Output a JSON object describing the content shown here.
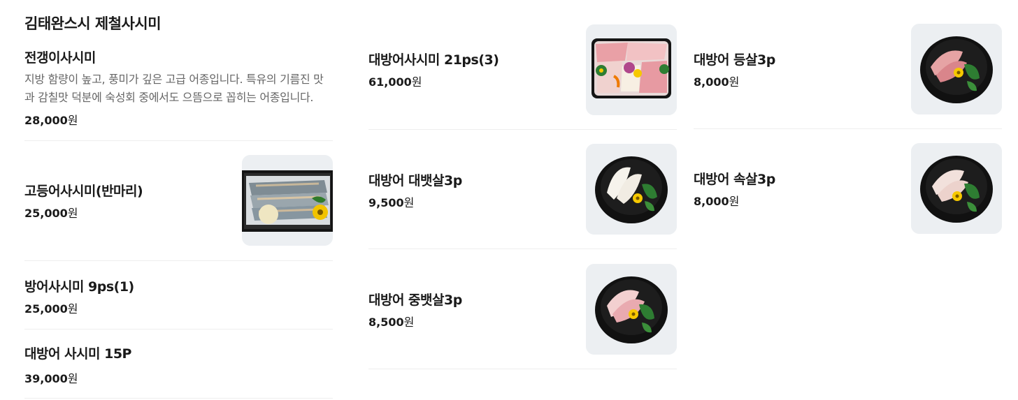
{
  "section": {
    "title": "김태완스시 제철사시미"
  },
  "col1": [
    {
      "name": "전갱이사시미",
      "desc": "지방 함량이 높고, 풍미가 깊은 고급 어종입니다. 특유의 기름진 맛과 감칠맛 덕분에 숙성회 중에서도 으뜸으로 꼽히는 어종입니다.",
      "price": "28,000",
      "won": "원"
    },
    {
      "name": "고등어사시미(반마리)",
      "price": "25,000",
      "won": "원",
      "image": "mackerel-sashimi-tray"
    },
    {
      "name": "방어사시미 9ps(1)",
      "price": "25,000",
      "won": "원"
    },
    {
      "name": "대방어 사시미 15P",
      "price": "39,000",
      "won": "원"
    }
  ],
  "col2": [
    {
      "name": "대방어사시미 21ps(3)",
      "price": "61,000",
      "won": "원",
      "image": "assorted-sashimi-tray"
    },
    {
      "name": "대방어 대뱃살3p",
      "price": "9,500",
      "won": "원",
      "image": "white-sashimi-bowl"
    },
    {
      "name": "대방어 중뱃살3p",
      "price": "8,500",
      "won": "원",
      "image": "pink-sashimi-bowl"
    }
  ],
  "col3": [
    {
      "name": "대방어 등살3p",
      "price": "8,000",
      "won": "원",
      "image": "red-sashimi-bowl"
    },
    {
      "name": "대방어 속살3p",
      "price": "8,000",
      "won": "원",
      "image": "pale-sashimi-bowl"
    }
  ],
  "colors": {
    "divider": "#eeeeee",
    "thumb_bg": "#eceff2",
    "text": "#1a1a1a",
    "desc": "#666666"
  }
}
